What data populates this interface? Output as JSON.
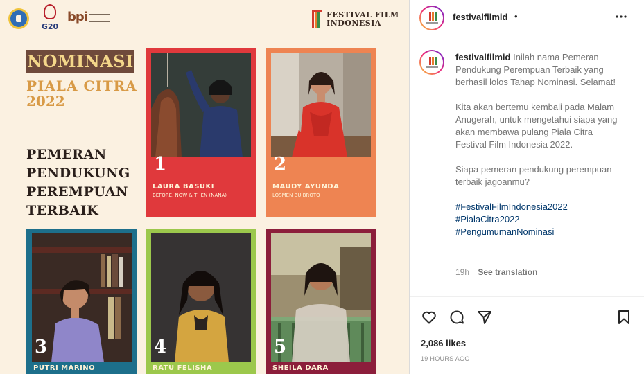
{
  "post_image": {
    "logos": {
      "g20_text": "G20",
      "bpi_text": "bpi",
      "festival_line1": "FESTIVAL FILM",
      "festival_line2": "INDONESIA"
    },
    "heading": "NOMINASI",
    "subheading": "PIALA CITRA",
    "year": "2022",
    "category_lines": [
      "PEMERAN",
      "PENDUKUNG",
      "PEREMPUAN",
      "TERBAIK"
    ],
    "nominees": [
      {
        "number": "1",
        "name": "LAURA BASUKI",
        "film": "BEFORE, NOW & THEN (NANA)",
        "color": "#e0393c"
      },
      {
        "number": "2",
        "name": "MAUDY AYUNDA",
        "film": "LOSMEN BU BROTO",
        "color": "#ee8452"
      },
      {
        "number": "3",
        "name": "PUTRI MARINO",
        "film": "",
        "color": "#1d6f8b"
      },
      {
        "number": "4",
        "name": "RATU FELISHA",
        "film": "",
        "color": "#9cc84c"
      },
      {
        "number": "5",
        "name": "SHEILA DARA",
        "film": "",
        "color": "#8c1e3b"
      }
    ]
  },
  "panel": {
    "username": "festivalfilmid",
    "dot": "•",
    "caption": {
      "username": "festivalfilmid",
      "p1": "Inilah nama Pemeran Pendukung Perempuan Terbaik yang berhasil lolos Tahap Nominasi. Selamat!",
      "p2": "Kita akan bertemu kembali pada Malam Anugerah, untuk mengetahui siapa yang akan membawa pulang Piala Citra Festival Film Indonesia 2022.",
      "p3": "Siapa pemeran pendukung perempuan terbaik jagoanmu?",
      "hashtags": [
        "#FestivalFilmIndonesia2022",
        "#PialaCitra2022",
        "#PengumumanNominasi"
      ]
    },
    "time_ago": "19h",
    "see_translation": "See translation",
    "likes": "2,086 likes",
    "posted": "19 HOURS AGO"
  },
  "icons": {
    "more": "more-horizontal-icon",
    "like": "heart-icon",
    "comment": "comment-icon",
    "share": "send-icon",
    "save": "bookmark-icon"
  },
  "colors": {
    "cream": "#fbf1e1",
    "brown": "#6f4a3b",
    "gold": "#d89a46",
    "hashtag": "#00376b"
  }
}
